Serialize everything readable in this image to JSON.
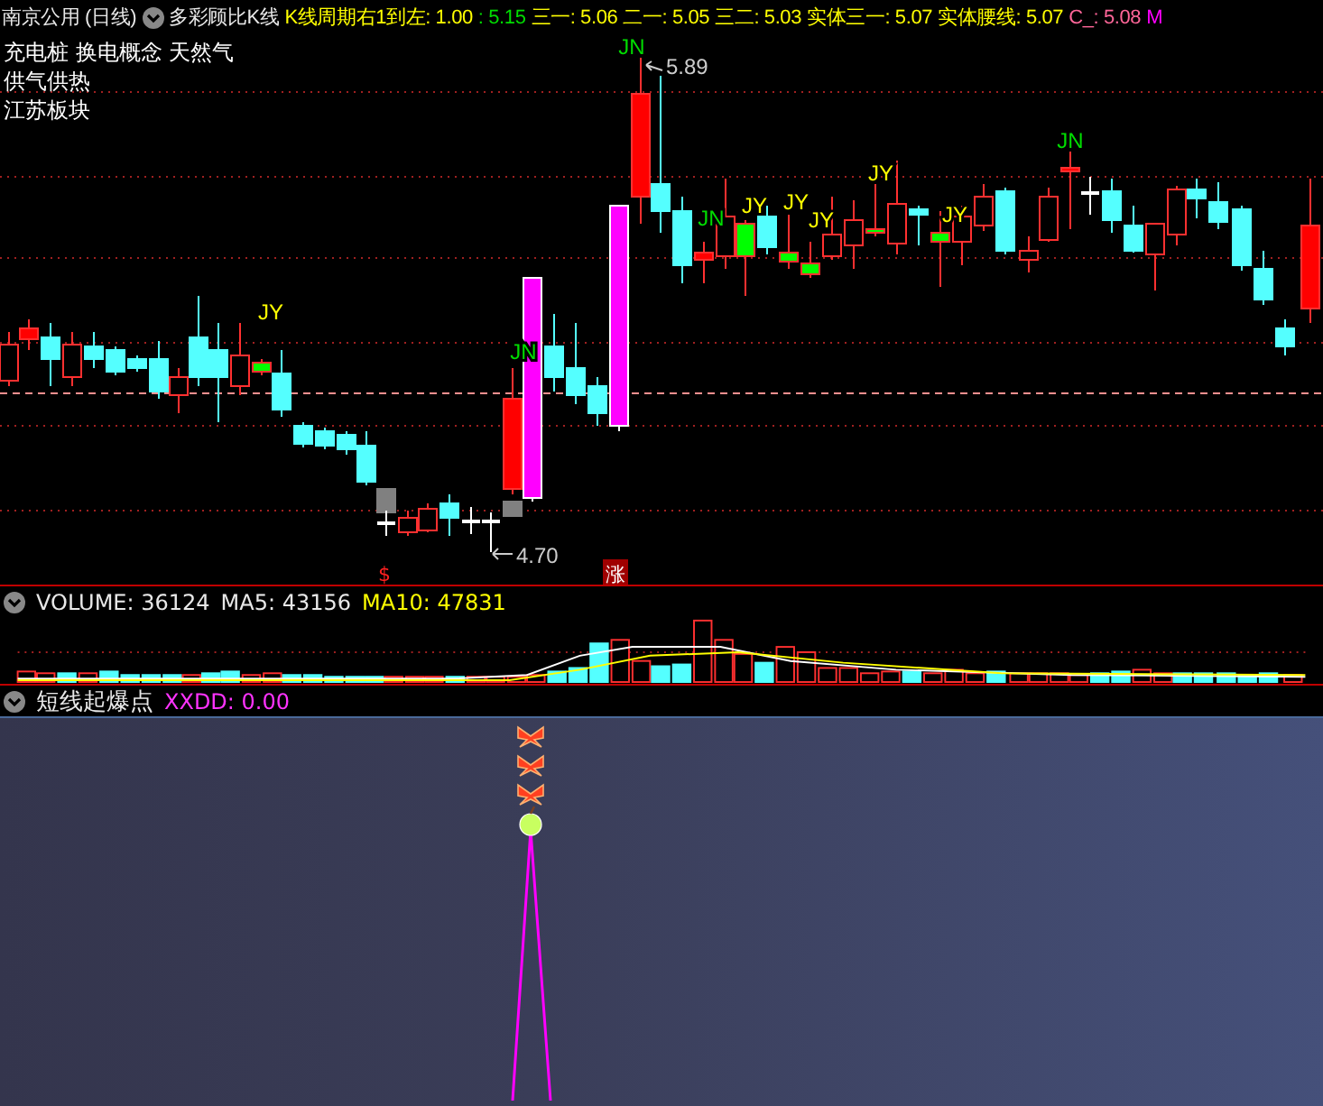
{
  "header": {
    "stock": "南京公用 (日线)",
    "indicator": "多彩顾比K线",
    "values": [
      {
        "text": "K线周期右1到左: 1.00",
        "color": "#ffff00"
      },
      {
        "text": ": 5.15",
        "color": "#00dd00"
      },
      {
        "text": "三一: 5.06",
        "color": "#ffff00"
      },
      {
        "text": "二一: 5.05",
        "color": "#ffff00"
      },
      {
        "text": "三二: 5.03",
        "color": "#ffff00"
      },
      {
        "text": "实体三一: 5.07",
        "color": "#ffff00"
      },
      {
        "text": "实体腰线: 5.07",
        "color": "#ffff00"
      },
      {
        "text": "C_: 5.08",
        "color": "#ff6699"
      },
      {
        "text": "M",
        "color": "#ff00ff"
      }
    ]
  },
  "concepts": [
    "充电桩 换电概念 天然气",
    "供气供热",
    "江苏板块"
  ],
  "price_chart": {
    "markers": [
      {
        "text": "JY",
        "kind": "jy"
      },
      {
        "text": "JN",
        "kind": "jn"
      },
      {
        "text": "JN",
        "kind": "jn"
      },
      {
        "text": "JN",
        "kind": "jn"
      },
      {
        "text": "JY",
        "kind": "jy"
      },
      {
        "text": "JY",
        "kind": "jy"
      },
      {
        "text": "JY",
        "kind": "jy"
      },
      {
        "text": "JY",
        "kind": "jy"
      },
      {
        "text": "JY",
        "kind": "jy"
      },
      {
        "text": "JN",
        "kind": "jn"
      }
    ],
    "high_label": "5.89",
    "low_label": "4.70",
    "signals": [
      {
        "text": "$",
        "kind": "dollar"
      },
      {
        "text": "涨",
        "kind": "rise"
      }
    ]
  },
  "volume": {
    "title": "VOLUME: 36124",
    "ma5": "MA5: 43156",
    "ma10": "MA10: 47831"
  },
  "signal_panel": {
    "title": "短线起爆点",
    "value": "XXDD: 0.00"
  }
}
